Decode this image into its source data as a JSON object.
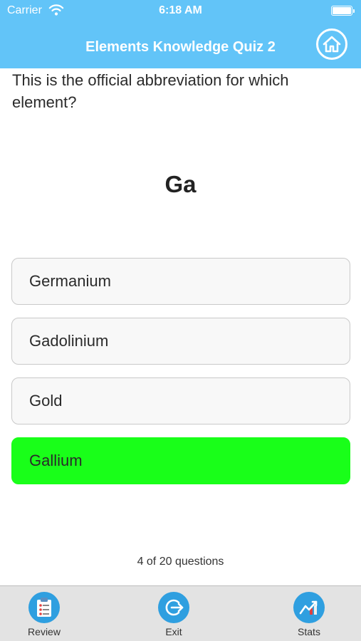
{
  "status": {
    "carrier": "Carrier",
    "time": "6:18 AM"
  },
  "header": {
    "title": "Elements Knowledge Quiz 2",
    "home_icon": "home-icon",
    "background": "#62c4f8"
  },
  "question": {
    "text": "This is the official abbreviation for which element?",
    "symbol": "Ga"
  },
  "answers": [
    {
      "label": "Germanium",
      "state": "default"
    },
    {
      "label": "Gadolinium",
      "state": "default"
    },
    {
      "label": "Gold",
      "state": "default"
    },
    {
      "label": "Gallium",
      "state": "correct",
      "color": "#19ff19"
    }
  ],
  "progress": {
    "text": "4 of 20 questions"
  },
  "tabbar": {
    "items": [
      {
        "label": "Review",
        "icon": "review-clipboard-icon"
      },
      {
        "label": "Exit",
        "icon": "exit-icon"
      },
      {
        "label": "Stats",
        "icon": "stats-chart-icon"
      }
    ]
  }
}
